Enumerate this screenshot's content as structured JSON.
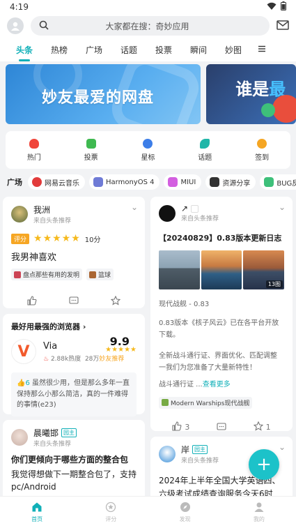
{
  "status": {
    "time": "4:19"
  },
  "search": {
    "placeholder": "大家都在搜：奇妙应用"
  },
  "tabs": [
    "头条",
    "热榜",
    "广场",
    "话题",
    "投票",
    "瞬间",
    "妙图"
  ],
  "banners": {
    "b1_text": "妙友最爱的网盘",
    "b2_text_a": "谁是",
    "b2_text_b": "最"
  },
  "quick": [
    {
      "label": "热门",
      "color": "#f0453a"
    },
    {
      "label": "投票",
      "color": "#3fb950"
    },
    {
      "label": "星标",
      "color": "#3d7ee8"
    },
    {
      "label": "话题",
      "color": "#1fb6a8"
    },
    {
      "label": "签到",
      "color": "#f5a623"
    }
  ],
  "plaza": {
    "title": "广场",
    "chips": [
      {
        "label": "网易云音乐",
        "color": "#e23b3b"
      },
      {
        "label": "HarmonyOS 4",
        "color": "#6f7bd6"
      },
      {
        "label": "MIUI",
        "color": "#d35fe0"
      },
      {
        "label": "资源分享",
        "color": "#333333"
      },
      {
        "label": "BUG反馈",
        "color": "#3ec07a"
      }
    ]
  },
  "card1": {
    "name": "我洲",
    "sub": "来自头条推荐",
    "rate_tag": "评分",
    "stars": "★★★★★",
    "score": "10分",
    "title": "我男神喜欢",
    "tag1": "盘点那些有用的发明",
    "tag2": "篮球"
  },
  "card2": {
    "heading": "最好用最强的浏览器",
    "app_name": "Via",
    "heat": "2.88k热度",
    "reviews": "28万",
    "recommend": "妙友推荐",
    "score": "9.9",
    "stars": "★★★★★",
    "quote_count": "6",
    "quote": "虽然很少用，但是那么多年一直保持那么小那么简洁，真的一件难得的事情(e23)"
  },
  "card3": {
    "name": "晨曦邯",
    "owner": "园主",
    "sub": "来自头条推荐",
    "title": "你们更倾向于哪些方面的整合包",
    "body": "我觉得想做下一期整合包了，支持pc/Android"
  },
  "card4": {
    "name": "↗",
    "sub": "来自头条推荐",
    "title": "【20240829】0.83版本更新日志",
    "img_count": "13图",
    "meta": "现代战舰 - 0.83",
    "p1": "0.83版本《核子风云》已在各平台开放下载。",
    "p2": "全新战斗通行证、界面优化、匹配调整 一我们为您准备了大量新特性！",
    "p3": "战斗通行证 ...",
    "more": "查看更多",
    "tag": "Modern Warships现代战舰",
    "likes": "3",
    "stars_count": "1"
  },
  "card5": {
    "name": "岸",
    "owner": "园主",
    "sub": "来自头条推荐",
    "title": "2024年上半年全国大学英语四、六级考试成绩查询服务今天6时"
  },
  "fab": "+",
  "bottomnav": [
    "首页",
    "评分",
    "发现",
    "我的"
  ]
}
